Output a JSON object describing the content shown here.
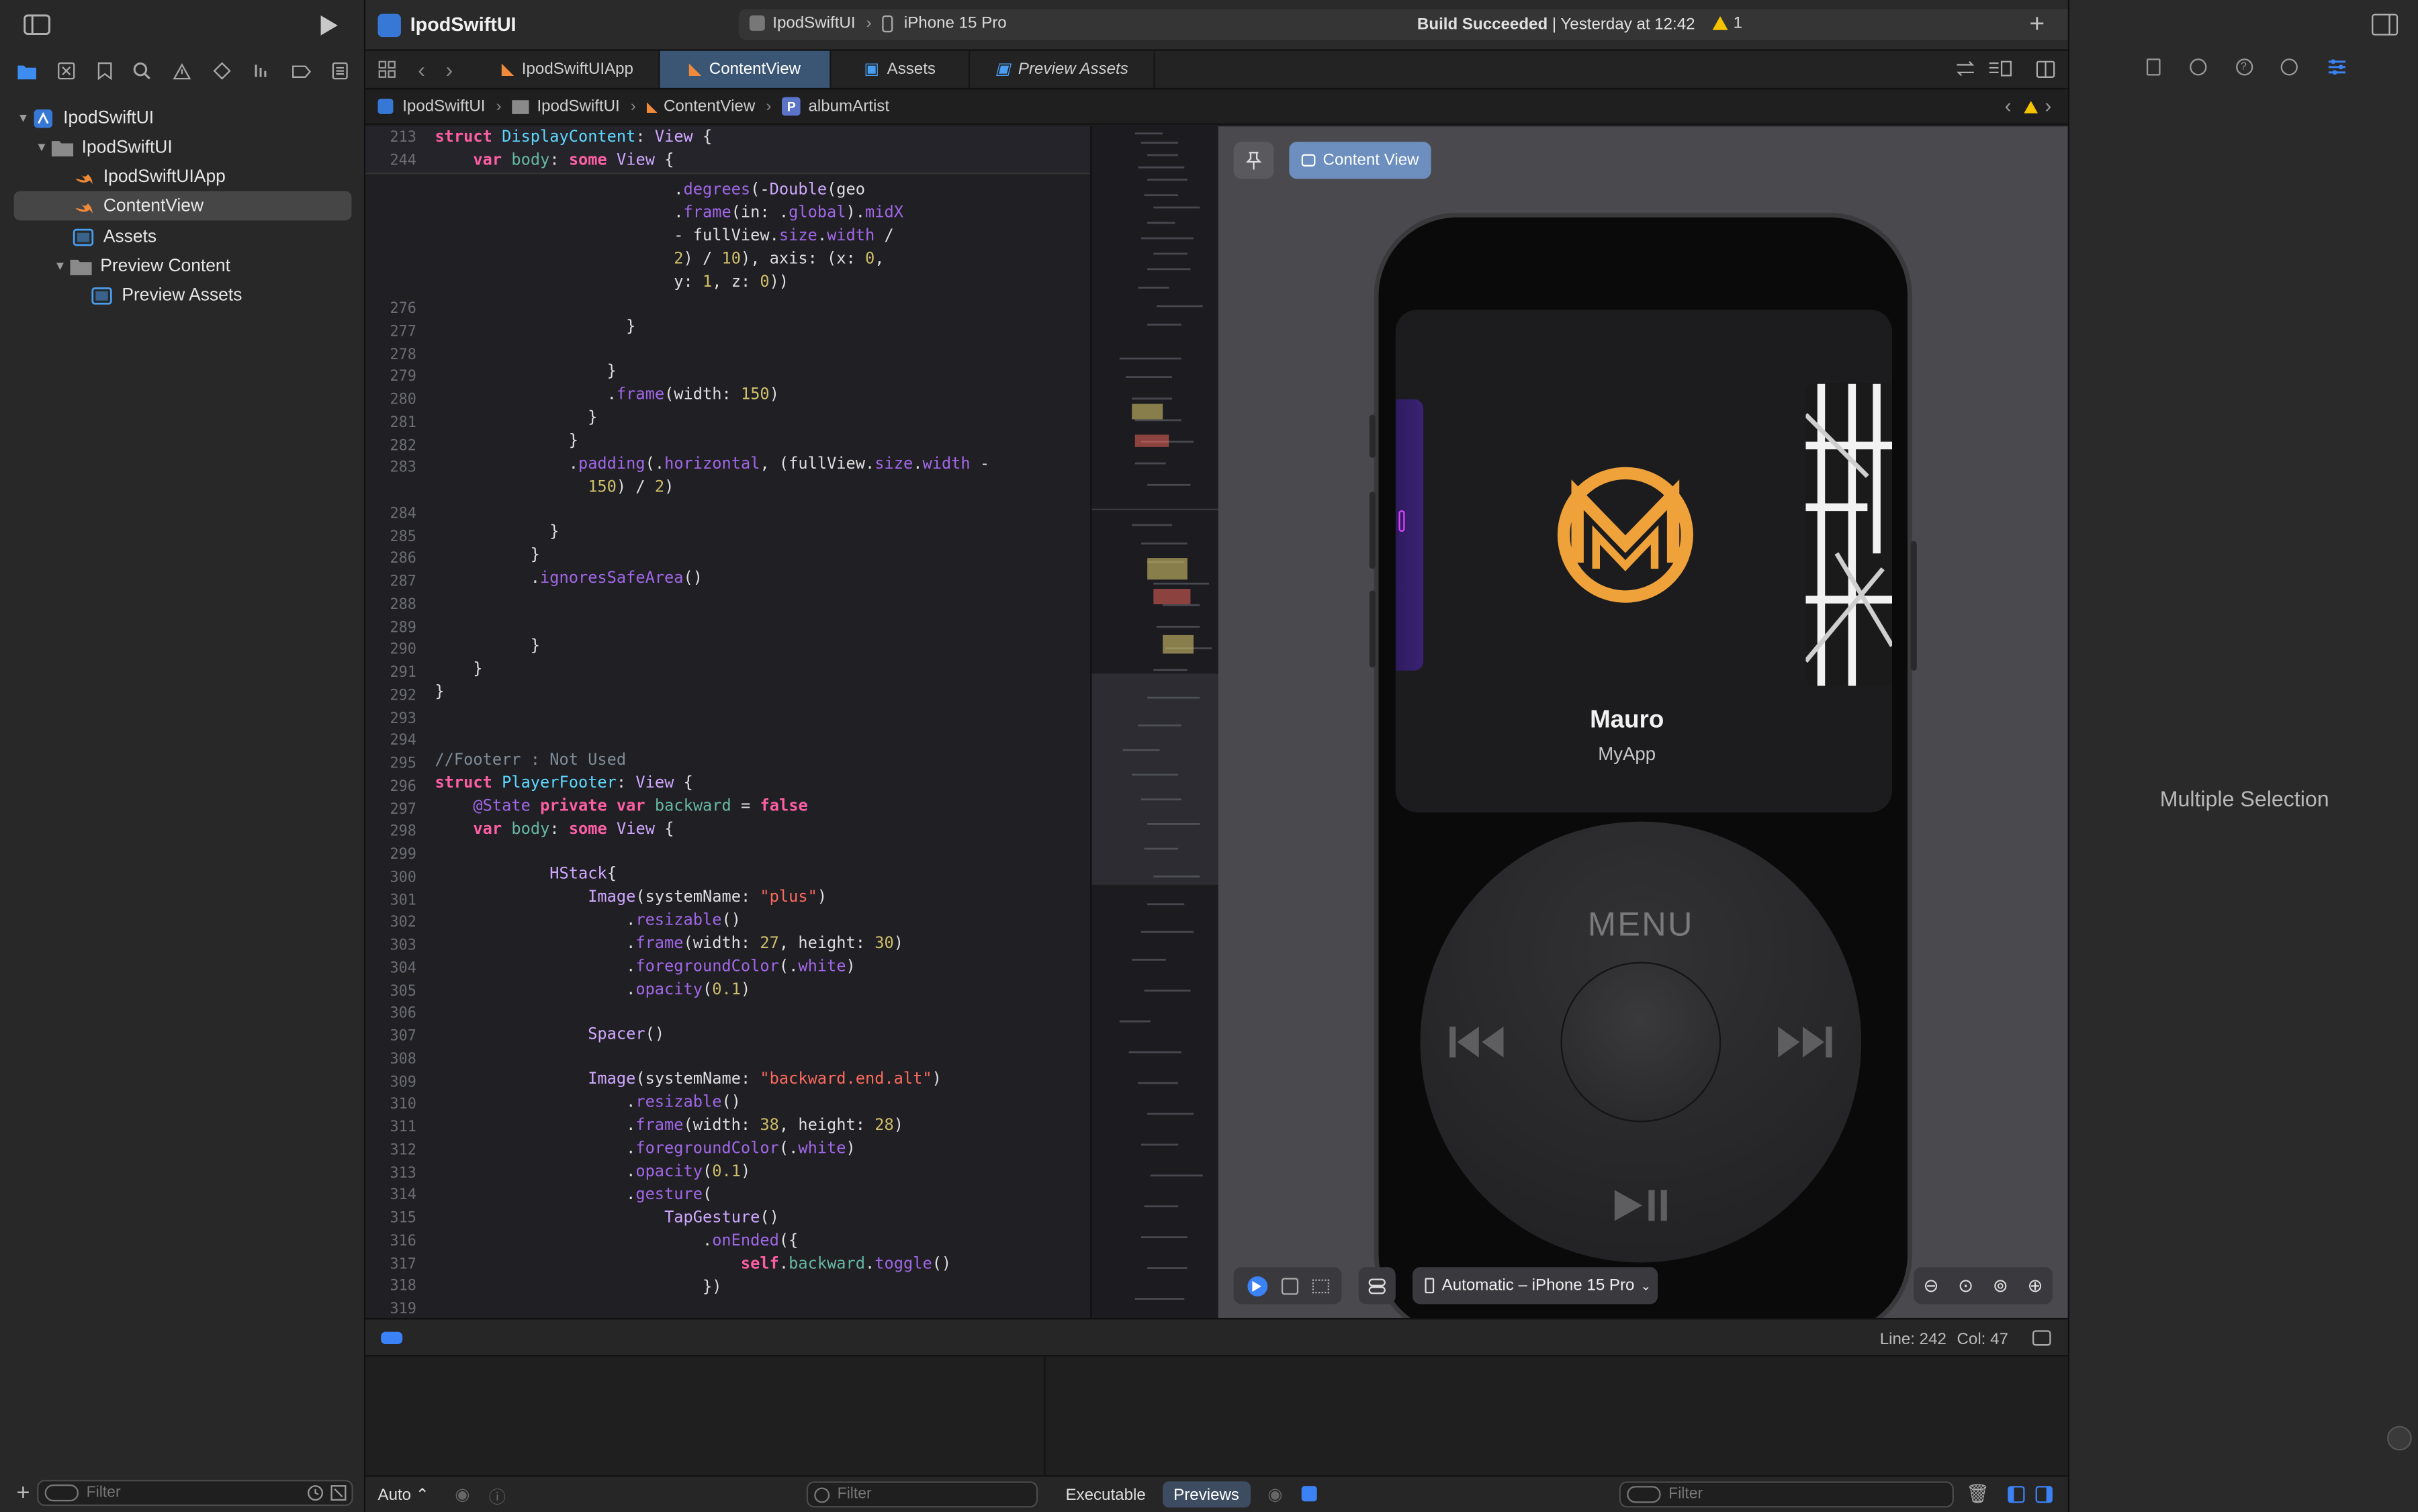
{
  "window": {
    "project": "IpodSwiftUI",
    "scheme": "IpodSwiftUI",
    "destination": "iPhone 15 Pro",
    "build_status_bold": "Build Succeeded",
    "build_status_time": "| Yesterday at 12:42",
    "warning_count": "1"
  },
  "navigator": {
    "items": [
      {
        "label": "IpodSwiftUI",
        "icon": "project-icon"
      },
      {
        "label": "IpodSwiftUI",
        "icon": "folder-icon"
      },
      {
        "label": "IpodSwiftUIApp",
        "icon": "swift-file-icon"
      },
      {
        "label": "ContentView",
        "icon": "swift-file-icon"
      },
      {
        "label": "Assets",
        "icon": "asset-catalog-icon"
      },
      {
        "label": "Preview Content",
        "icon": "folder-icon"
      },
      {
        "label": "Preview Assets",
        "icon": "asset-catalog-icon"
      }
    ],
    "filter_placeholder": "Filter"
  },
  "tabs": [
    {
      "label": "IpodSwiftUIApp"
    },
    {
      "label": "ContentView"
    },
    {
      "label": "Assets"
    },
    {
      "label": "Preview Assets"
    }
  ],
  "jumpbar": {
    "crumbs": [
      "IpodSwiftUI",
      "IpodSwiftUI",
      "ContentView"
    ],
    "symbol_badge": "P",
    "symbol": "albumArtist"
  },
  "editor": {
    "sticky": [
      {
        "n": "213",
        "code": "struct DisplayContent: View {"
      },
      {
        "n": "244",
        "code": "    var body: some View {"
      }
    ],
    "partial": [
      "                         .degrees(-Double(geo",
      "                         .frame(in: .global).midX",
      "                         - fullView.size.width /",
      "                         2) / 10), axis: (x: 0,",
      "                         y: 1, z: 0))"
    ],
    "numbers": [
      "276",
      "277",
      "278",
      "279",
      "280",
      "281",
      "282",
      "283",
      "284",
      "285",
      "286",
      "287",
      "288",
      "289",
      "290",
      "291",
      "292",
      "293",
      "294",
      "295",
      "296",
      "297",
      "298",
      "299",
      "300",
      "301",
      "302",
      "303",
      "304",
      "305",
      "306",
      "307",
      "308",
      "309",
      "310",
      "311",
      "312",
      "313",
      "314",
      "315",
      "316",
      "317",
      "318",
      "319"
    ]
  },
  "preview": {
    "pin_label": "Content View",
    "artist": "Mauro",
    "app": "MyApp",
    "menu": "MENU",
    "device": "Automatic – iPhone 15 Pro",
    "logo_color": "#f0a23a"
  },
  "status": {
    "line": "Line: 242",
    "col": "Col: 47"
  },
  "debug": {
    "auto": "Auto",
    "filter": "Filter",
    "executable": "Executable",
    "previews": "Previews",
    "filter2": "Filter"
  },
  "inspector": {
    "message": "Multiple Selection"
  }
}
